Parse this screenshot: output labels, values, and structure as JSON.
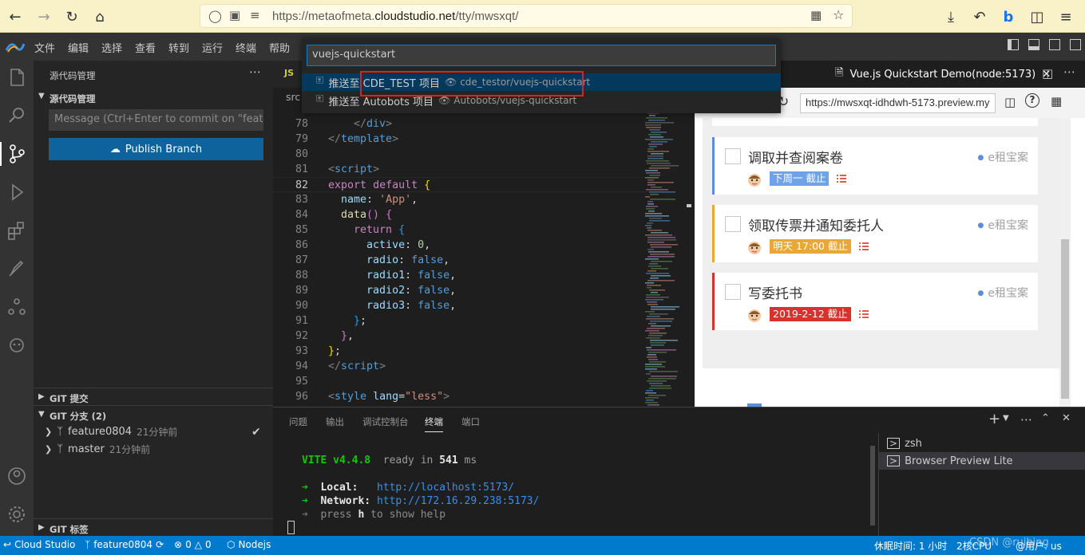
{
  "browser": {
    "url_prefix": "https://metaofmeta.",
    "url_host": "cloudstudio.net",
    "url_path": "/tty/mwsxqt/"
  },
  "menubar": {
    "items": [
      "文件",
      "编辑",
      "选择",
      "查看",
      "转到",
      "运行",
      "终端",
      "帮助"
    ]
  },
  "sidebar": {
    "header": "源代码管理",
    "section": "源代码管理",
    "commit_placeholder": "Message (Ctrl+Enter to commit on \"featur...",
    "publish_label": "Publish Branch",
    "git_commits": "GIT 提交",
    "git_branches": "GIT 分支",
    "branch_count": "(2)",
    "branches": [
      {
        "name": "feature0804",
        "time": "21分钟前"
      },
      {
        "name": "master",
        "time": "21分钟前"
      }
    ],
    "git_tags": "GIT 标签"
  },
  "editor": {
    "tab_label": "JS",
    "breadcrumb": "src",
    "lines": [
      {
        "n": "78",
        "tokens": [
          [
            "    ",
            "t-plain"
          ],
          [
            "</",
            "t-tag"
          ],
          [
            "div",
            "t-name"
          ],
          [
            ">",
            "t-tag"
          ]
        ]
      },
      {
        "n": "79",
        "tokens": [
          [
            "</",
            "t-tag"
          ],
          [
            "template",
            "t-name"
          ],
          [
            ">",
            "t-tag"
          ]
        ]
      },
      {
        "n": "80",
        "tokens": []
      },
      {
        "n": "81",
        "tokens": [
          [
            "<",
            "t-tag"
          ],
          [
            "script",
            "t-name"
          ],
          [
            ">",
            "t-tag"
          ]
        ]
      },
      {
        "n": "82",
        "tokens": [
          [
            "export",
            "t-kw"
          ],
          [
            " ",
            "t-plain"
          ],
          [
            "default",
            "t-kw"
          ],
          [
            " ",
            "t-plain"
          ],
          [
            "{",
            "t-b1"
          ]
        ]
      },
      {
        "n": "83",
        "tokens": [
          [
            "  ",
            "t-plain"
          ],
          [
            "name",
            "t-prop"
          ],
          [
            ": ",
            "t-plain"
          ],
          [
            "'App'",
            "t-str"
          ],
          [
            ",",
            "t-plain"
          ]
        ]
      },
      {
        "n": "84",
        "tokens": [
          [
            "  ",
            "t-plain"
          ],
          [
            "data",
            "t-fn"
          ],
          [
            "()",
            "t-b2"
          ],
          [
            " ",
            "t-plain"
          ],
          [
            "{",
            "t-b2"
          ]
        ]
      },
      {
        "n": "85",
        "tokens": [
          [
            "    ",
            "t-plain"
          ],
          [
            "return",
            "t-kw"
          ],
          [
            " ",
            "t-plain"
          ],
          [
            "{",
            "t-b3"
          ]
        ]
      },
      {
        "n": "86",
        "tokens": [
          [
            "      ",
            "t-plain"
          ],
          [
            "active",
            "t-prop"
          ],
          [
            ": ",
            "t-plain"
          ],
          [
            "0",
            "t-num"
          ],
          [
            ",",
            "t-plain"
          ]
        ]
      },
      {
        "n": "87",
        "tokens": [
          [
            "      ",
            "t-plain"
          ],
          [
            "radio",
            "t-prop"
          ],
          [
            ": ",
            "t-plain"
          ],
          [
            "false",
            "t-bool"
          ],
          [
            ",",
            "t-plain"
          ]
        ]
      },
      {
        "n": "88",
        "tokens": [
          [
            "      ",
            "t-plain"
          ],
          [
            "radio1",
            "t-prop"
          ],
          [
            ": ",
            "t-plain"
          ],
          [
            "false",
            "t-bool"
          ],
          [
            ",",
            "t-plain"
          ]
        ]
      },
      {
        "n": "89",
        "tokens": [
          [
            "      ",
            "t-plain"
          ],
          [
            "radio2",
            "t-prop"
          ],
          [
            ": ",
            "t-plain"
          ],
          [
            "false",
            "t-bool"
          ],
          [
            ",",
            "t-plain"
          ]
        ]
      },
      {
        "n": "90",
        "tokens": [
          [
            "      ",
            "t-plain"
          ],
          [
            "radio3",
            "t-prop"
          ],
          [
            ": ",
            "t-plain"
          ],
          [
            "false",
            "t-bool"
          ],
          [
            ",",
            "t-plain"
          ]
        ]
      },
      {
        "n": "91",
        "tokens": [
          [
            "    ",
            "t-plain"
          ],
          [
            "}",
            "t-b3"
          ],
          [
            ";",
            "t-plain"
          ]
        ]
      },
      {
        "n": "92",
        "tokens": [
          [
            "  ",
            "t-plain"
          ],
          [
            "}",
            "t-b2"
          ],
          [
            ",",
            "t-plain"
          ]
        ]
      },
      {
        "n": "93",
        "tokens": [
          [
            "}",
            "t-b1"
          ],
          [
            ";",
            "t-plain"
          ]
        ]
      },
      {
        "n": "94",
        "tokens": [
          [
            "</",
            "t-tag"
          ],
          [
            "script",
            "t-name"
          ],
          [
            ">",
            "t-tag"
          ]
        ]
      },
      {
        "n": "95",
        "tokens": []
      },
      {
        "n": "96",
        "tokens": [
          [
            "<",
            "t-tag"
          ],
          [
            "style",
            "t-name"
          ],
          [
            " ",
            "t-plain"
          ],
          [
            "lang",
            "t-prop"
          ],
          [
            "=",
            "t-plain"
          ],
          [
            "\"less\"",
            "t-str"
          ],
          [
            ">",
            "t-tag"
          ]
        ]
      }
    ]
  },
  "palette": {
    "input_value": "vuejs-quickstart",
    "rows": [
      {
        "label_prefix": "推送至 ",
        "label": "CDE_TEST 项目",
        "desc": "cde_testor/vuejs-quickstart"
      },
      {
        "label_prefix": "推送至 ",
        "label": "Autobots 项目",
        "desc": "Autobots/vuejs-quickstart"
      }
    ]
  },
  "preview": {
    "tab_title": "Vue.js Quickstart Demo(node:5173)",
    "url": "https://mwsxqt-idhdwh-5173.preview.my",
    "cards": [
      {
        "title": "调取并查阅案卷",
        "category": "e租宝案",
        "badge": "下周一 截止",
        "border": "#5b8ed6",
        "badge_color": "#6fa2e8"
      },
      {
        "title": "领取传票并通知委托人",
        "category": "e租宝案",
        "badge": "明天 17:00 截止",
        "border": "#e8a838",
        "badge_color": "#e8a838"
      },
      {
        "title": "写委托书",
        "category": "e租宝案",
        "badge": "2019-2-12 截止",
        "border": "#d9312b",
        "badge_color": "#d9312b"
      }
    ]
  },
  "panel": {
    "tabs": [
      "问题",
      "输出",
      "调试控制台",
      "终端",
      "端口"
    ],
    "active_tab": "终端",
    "terminal": {
      "vite": "VITE v4.4.8",
      "ready": "ready in",
      "ms": "541",
      "ms_unit": "ms",
      "local_label": "Local:",
      "local_url": "http://localhost:5173/",
      "network_label": "Network:",
      "network_url": "http://172.16.29.238:5173/",
      "help_prefix": "press",
      "help_key": "h",
      "help_suffix": "to show help"
    },
    "terminals": [
      "zsh",
      "Browser Preview Lite"
    ]
  },
  "statusbar": {
    "app": "Cloud Studio",
    "branch": "feature0804",
    "errors": "0",
    "warnings": "0",
    "runtime": "Nodejs",
    "rest": "休眠时间: 1 小时",
    "cpu": "2核CPU",
    "used": "@用户: us",
    "watermark": "CSDN @ruibing"
  },
  "colors": {
    "accent": "#007acc",
    "button": "#0e639c",
    "highlight": "#e0201a"
  }
}
